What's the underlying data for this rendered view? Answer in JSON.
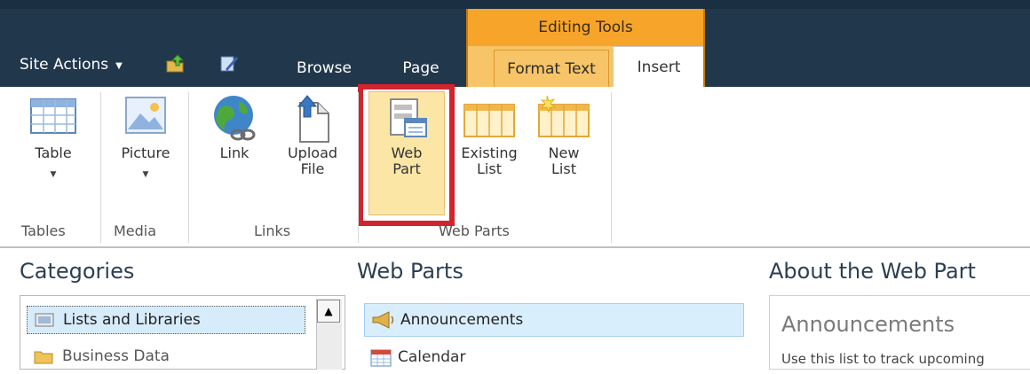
{
  "header": {
    "site_actions": "Site Actions",
    "contextual_group": "Editing Tools",
    "tabs": [
      {
        "label": "Browse"
      },
      {
        "label": "Page"
      },
      {
        "label": "Format Text"
      },
      {
        "label": "Insert"
      }
    ]
  },
  "ribbon": {
    "groups": [
      {
        "label": "Tables",
        "buttons": [
          {
            "label": "Table"
          }
        ]
      },
      {
        "label": "Media",
        "buttons": [
          {
            "label": "Picture"
          }
        ]
      },
      {
        "label": "Links",
        "buttons": [
          {
            "label": "Link"
          },
          {
            "label": "Upload\nFile"
          }
        ]
      },
      {
        "label": "Web Parts",
        "buttons": [
          {
            "label": "Web\nPart"
          },
          {
            "label": "Existing\nList"
          },
          {
            "label": "New\nList"
          }
        ]
      }
    ]
  },
  "panes": {
    "categories_title": "Categories",
    "categories": [
      "Lists and Libraries",
      "Business Data"
    ],
    "webparts_title": "Web Parts",
    "webparts": [
      "Announcements",
      "Calendar"
    ],
    "about_title": "About the Web Part",
    "about_name": "Announcements",
    "about_desc": "Use this list to track upcoming"
  },
  "colors": {
    "header_bg": "#21374c",
    "contextual_orange": "#f6a52a",
    "highlight_red": "#d0242f",
    "selection_blue": "#d9eefc"
  }
}
